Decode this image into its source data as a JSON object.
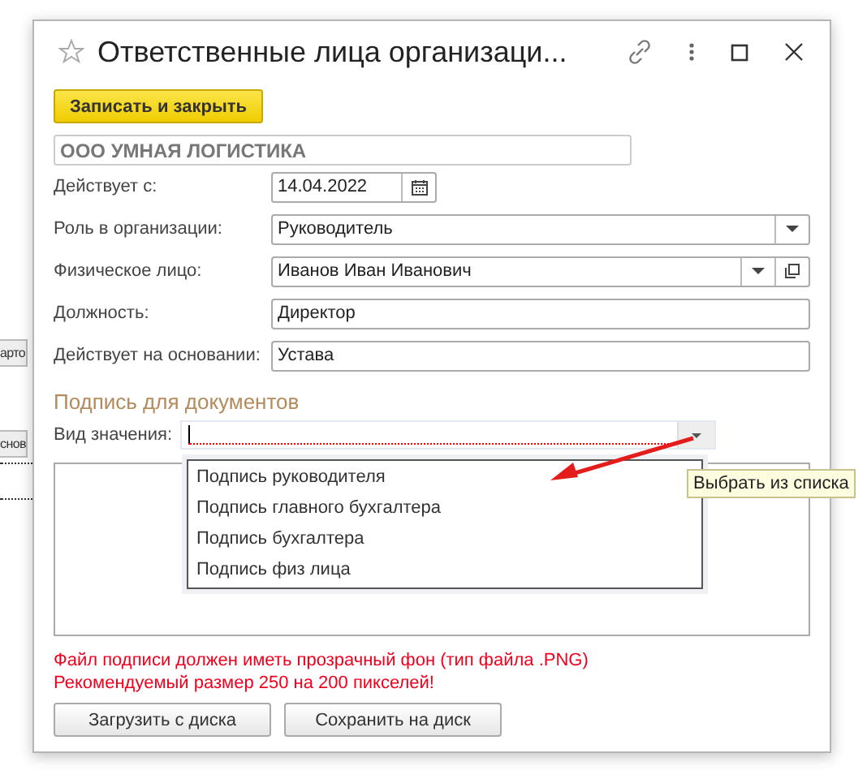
{
  "background_fragments": [
    "арто",
    "снов"
  ],
  "window": {
    "title": "Ответственные лица организаци..."
  },
  "save_button": "Записать и закрыть",
  "organization": "ООО УМНАЯ ЛОГИСТИКА",
  "fields": [
    {
      "label": "Действует с:",
      "value": "14.04.2022",
      "kind": "date"
    },
    {
      "label": "Роль в организации:",
      "value": "Руководитель",
      "kind": "select"
    },
    {
      "label": "Физическое лицо:",
      "value": "Иванов Иван Иванович",
      "kind": "select-open"
    },
    {
      "label": "Должность:",
      "value": "Директор",
      "kind": "text"
    },
    {
      "label": "Действует на основании:",
      "value": "Устава",
      "kind": "text"
    }
  ],
  "signature": {
    "heading": "Подпись для документов",
    "type_label": "Вид значения:",
    "options": [
      "Подпись руководителя",
      "Подпись главного бухгалтера",
      "Подпись бухгалтера",
      "Подпись физ лица"
    ],
    "tooltip": "Выбрать из списка",
    "notes": [
      "Файл подписи должен иметь прозрачный фон (тип файла .PNG)",
      "Рекомендуемый размер 250 на 200 пикселей!"
    ],
    "buttons": [
      "Загрузить с диска",
      "Сохранить на диск"
    ]
  }
}
